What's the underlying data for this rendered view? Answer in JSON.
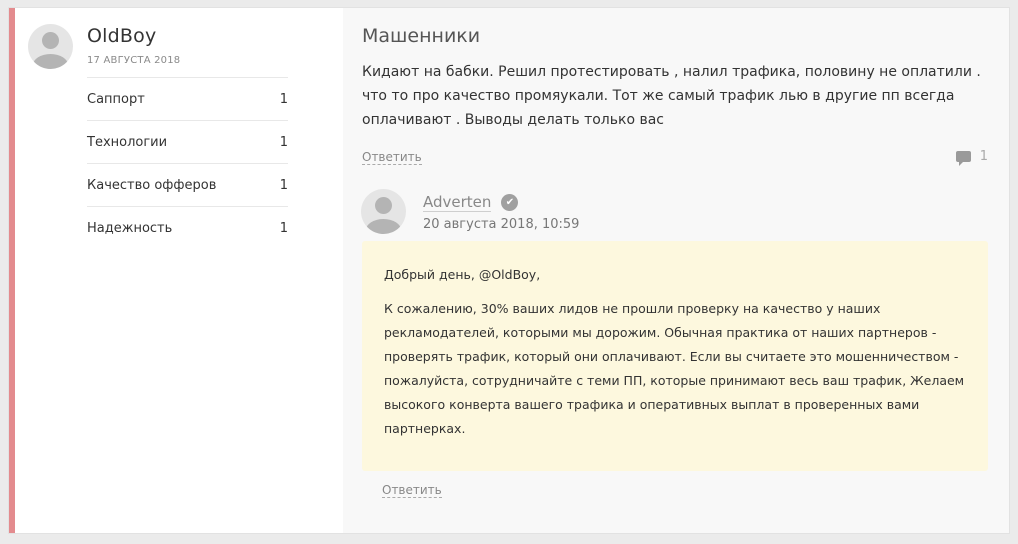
{
  "user": {
    "name": "OldBoy",
    "date": "17 АВГУСТА 2018"
  },
  "tags": [
    {
      "label": "Саппорт",
      "count": "1"
    },
    {
      "label": "Технологии",
      "count": "1"
    },
    {
      "label": "Качество офферов",
      "count": "1"
    },
    {
      "label": "Надежность",
      "count": "1"
    }
  ],
  "post": {
    "title": "Машенники",
    "text": "Кидают на бабки. Решил протестировать , налил трафика, половину не оплатили . что то про качество промяукали. Тот же самый трафик лью в другие пп всегда оплачивают . Выводы делать только вас",
    "reply_label": "Ответить",
    "comment_count": "1"
  },
  "answer": {
    "author": "Adverten",
    "date": "20 августа 2018, 10:59",
    "greeting": "Добрый день, @OldBoy,",
    "text": "К сожалению, 30% ваших лидов не прошли проверку на качество у наших рекламодателей, которыми мы дорожим. Обычная практика от наших партнеров - проверять трафик, который они оплачивают. Если вы считаете это мошенничеством - пожалуйста, сотрудничайте с теми ПП, которые принимают весь ваш трафик, Желаем высокого конверта вашего трафика и оперативных выплат в проверенных вами партнерках.",
    "reply_label": "Ответить"
  },
  "colors": {
    "accent": "#e38b8e",
    "answer_bg": "#fdf8de"
  },
  "icons": [
    "user-avatar-icon",
    "comment-bubble-icon",
    "verified-check-icon"
  ]
}
